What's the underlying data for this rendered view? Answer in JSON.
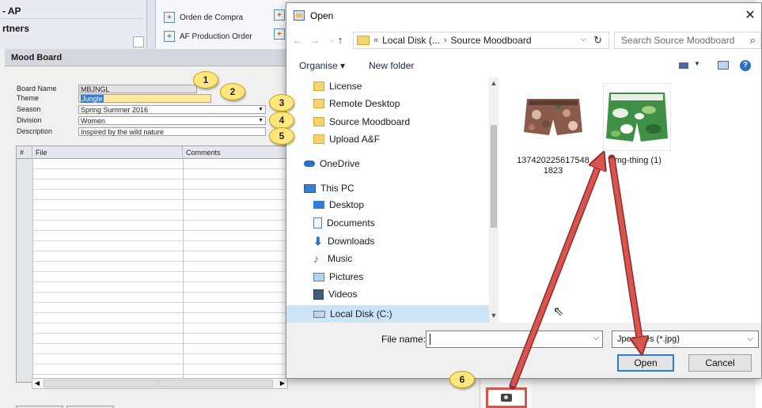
{
  "background_app": {
    "nav_items": [
      "- AP",
      "rtners"
    ],
    "menu_items": [
      "Orden de Compra",
      "AF Production Order"
    ]
  },
  "mood_board": {
    "title": "Mood Board",
    "fields": [
      {
        "label": "Board Name",
        "value": "MBJNGL"
      },
      {
        "label": "Theme",
        "value": "Jungle"
      },
      {
        "label": "Season",
        "value": "Spring Summer 2016"
      },
      {
        "label": "Division",
        "value": "Women"
      },
      {
        "label": "Description",
        "value": "Inspired by the wild nature"
      }
    ],
    "grid_columns": [
      "#",
      "File",
      "Comments"
    ],
    "scroll_thumb_label": ":::"
  },
  "dialog": {
    "title": "Open",
    "close_glyph": "✕",
    "address": {
      "overflow": "«",
      "segments": [
        "Local Disk (...",
        "Source Moodboard"
      ],
      "separator": "›"
    },
    "search": {
      "placeholder": "Search Source Moodboard"
    },
    "toolbar": {
      "organise": "Organise ▾",
      "new_folder": "New folder",
      "help": "?"
    },
    "nav_items": [
      {
        "label": "License",
        "icon": "folder-icon"
      },
      {
        "label": "Remote Desktop",
        "icon": "folder-icon"
      },
      {
        "label": "Source Moodboard",
        "icon": "folder-icon"
      },
      {
        "label": "Upload A&F",
        "icon": "folder-icon"
      },
      {
        "label": "OneDrive",
        "icon": "onedrive-icon"
      },
      {
        "label": "This PC",
        "icon": "pc-icon"
      },
      {
        "label": "Desktop",
        "icon": "desktop-icon"
      },
      {
        "label": "Documents",
        "icon": "documents-icon"
      },
      {
        "label": "Downloads",
        "icon": "downloads-icon"
      },
      {
        "label": "Music",
        "icon": "music-icon"
      },
      {
        "label": "Pictures",
        "icon": "pictures-icon"
      },
      {
        "label": "Videos",
        "icon": "videos-icon"
      },
      {
        "label": "Local Disk (C:)",
        "icon": "local-disk-icon"
      }
    ],
    "files": [
      {
        "label_line1": "137420225617548",
        "label_line2": "1823"
      },
      {
        "label_line1": "img-thing (1)",
        "label_line2": ""
      }
    ],
    "file_name_label": "File name:",
    "file_name_value": "",
    "file_type": "Jpeg files (*.jpg)",
    "open_label": "Open",
    "cancel_label": "Cancel"
  },
  "callouts": [
    "1",
    "2",
    "3",
    "4",
    "5",
    "6"
  ],
  "colors": {
    "callout_fill": "#ffe680",
    "arrow": "#d9534f",
    "theme_highlight": "#ffe99a",
    "selection": "#cce4f7"
  }
}
